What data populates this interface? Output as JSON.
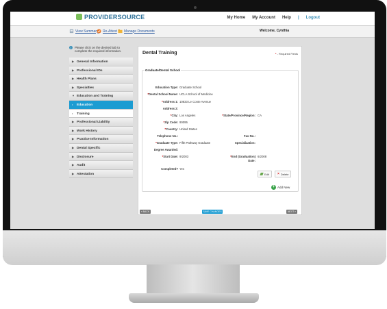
{
  "app": {
    "logo_brand": "PROVIDERSOURCE",
    "logo_prefix": ""
  },
  "topnav": {
    "home": "My Home",
    "account": "My Account",
    "help": "Help",
    "sep": "|",
    "logout": "Logout"
  },
  "subbar": {
    "view_summary": "View Summary",
    "reattest": "Re-Attest",
    "manage_documents": "Manage Documents",
    "welcome": "Welcome, Cynthia"
  },
  "sidebar": {
    "help_text": "Please click on the desired tab to complete the required information.",
    "items": [
      {
        "label": "General Information",
        "arrow": "▶"
      },
      {
        "label": "Professional IDs",
        "arrow": "▶"
      },
      {
        "label": "Health Plans",
        "arrow": "▶"
      },
      {
        "label": "Specialties",
        "arrow": "▶"
      },
      {
        "label": "Education and Training",
        "arrow": "▼"
      },
      {
        "label": "Education",
        "arrow": "•"
      },
      {
        "label": "Training",
        "arrow": "•"
      },
      {
        "label": "Professional Liability",
        "arrow": "▶"
      },
      {
        "label": "Work History",
        "arrow": "▶"
      },
      {
        "label": "Practice Information",
        "arrow": "▶"
      },
      {
        "label": "Dental Specific",
        "arrow": "▶"
      },
      {
        "label": "Disclosure",
        "arrow": "▶"
      },
      {
        "label": "Audit",
        "arrow": "▶"
      },
      {
        "label": "Attestation",
        "arrow": "▶"
      }
    ]
  },
  "main": {
    "title": "Dental Training",
    "required_star": "*",
    "required_text": " - Required Fields",
    "section_title": "Graduate/Dental School",
    "fields": {
      "education_type": {
        "label": "Education Type:",
        "value": "Graduate School"
      },
      "school_name": {
        "label": "Dental School Name:",
        "value": "UCLA School of Medicine"
      },
      "address1": {
        "label": "Address 1:",
        "value": "10833 Le Conte Avenue"
      },
      "address2": {
        "label": "Address 2:",
        "value": ""
      },
      "city": {
        "label": "City:",
        "value": "Los Angeles"
      },
      "state": {
        "label": "State/Province/Region:",
        "value": "CA"
      },
      "zip": {
        "label": "Zip Code:",
        "value": "90095"
      },
      "country": {
        "label": "Country:",
        "value": "United States"
      },
      "telephone": {
        "label": "Telephone No.:",
        "value": ""
      },
      "fax": {
        "label": "Fax No.:",
        "value": ""
      },
      "grad_type": {
        "label": "Graduate Type:",
        "value": "Fifth Pathway Graduate"
      },
      "specialization": {
        "label": "Specialization:",
        "value": ""
      },
      "degree": {
        "label": "Degree Awarded:",
        "value": ""
      },
      "start_date": {
        "label": "Start Date:",
        "value": "9/2003"
      },
      "end_date": {
        "label": "End (Graduation) Date:",
        "value": "6/2008"
      },
      "completed": {
        "label": "Completed?",
        "value": "Yes"
      }
    },
    "edit_label": "Edit",
    "delete_label": "Delete",
    "add_new_label": "Add New"
  },
  "footer": {
    "back": "« BACK",
    "save": "SAVE CHANGES",
    "next": "NEXT »"
  },
  "colors": {
    "accent": "#1c9cd2",
    "required": "#cc0000",
    "add": "#3aa34a"
  }
}
